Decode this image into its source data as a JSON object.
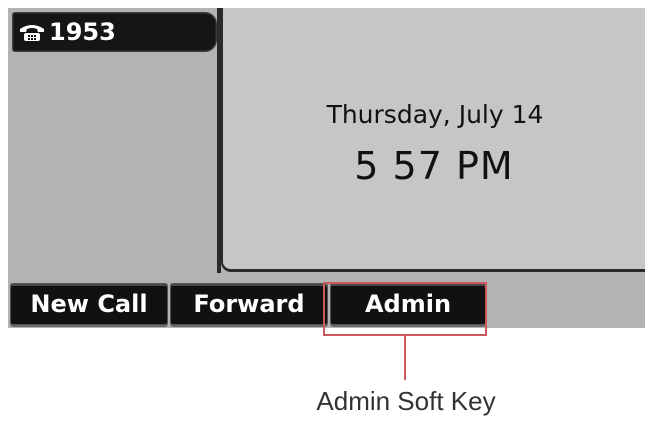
{
  "line_key": {
    "icon": "phone-handset-icon",
    "number": "1953"
  },
  "idle_screen": {
    "date": "Thursday, July 14",
    "time": "5 57 PM"
  },
  "soft_keys": [
    {
      "label": "New Call"
    },
    {
      "label": "Forward"
    },
    {
      "label": "Admin"
    }
  ],
  "annotation": {
    "label": "Admin Soft Key",
    "color": "#c8595d",
    "target": "Admin"
  }
}
